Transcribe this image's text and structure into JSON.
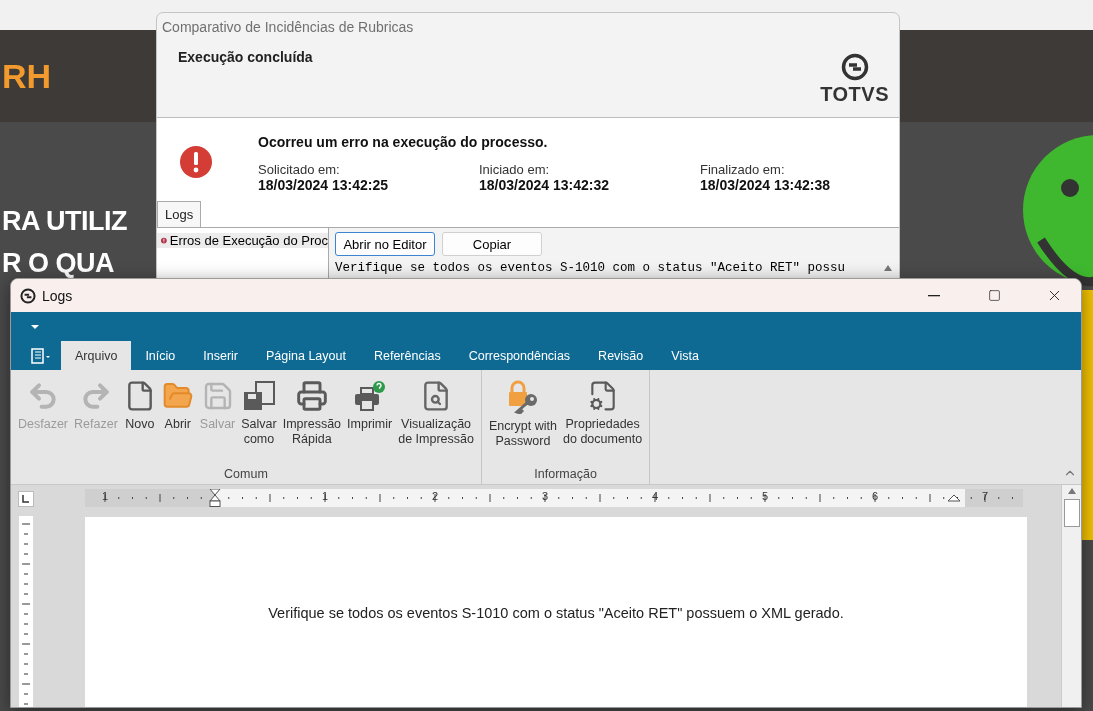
{
  "background_page": {
    "logo_text": "RH",
    "headline_lines": [
      "RA UTILIZ",
      "R O QUA"
    ]
  },
  "dialog": {
    "title": "Comparativo de Incidências de Rubricas",
    "heading": "Execução concluída",
    "brand": "TOTVS",
    "message": "Ocorreu um erro na execução do processo.",
    "times": [
      {
        "label": "Solicitado em:",
        "value": "18/03/2024 13:42:25"
      },
      {
        "label": "Iniciado em:",
        "value": "18/03/2024 13:42:32"
      },
      {
        "label": "Finalizado em:",
        "value": "18/03/2024 13:42:38"
      }
    ],
    "tabs": [
      {
        "label": "Logs",
        "selected": true
      }
    ],
    "log_items": [
      {
        "label": "Erros de Execução do Proc",
        "selected": true
      }
    ],
    "buttons": [
      {
        "label": "Abrir no Editor",
        "focused": true
      },
      {
        "label": "Copiar",
        "focused": false
      }
    ],
    "log_text": "Verifique se todos os eventos S-1010 com o status \"Aceito RET\" possu"
  },
  "logs_window": {
    "title": "Logs",
    "ribbon_tabs": [
      {
        "label": "Arquivo",
        "selected": true
      },
      {
        "label": "Início",
        "selected": false
      },
      {
        "label": "Inserir",
        "selected": false
      },
      {
        "label": "Página Layout",
        "selected": false
      },
      {
        "label": "Referências",
        "selected": false
      },
      {
        "label": "Correspondências",
        "selected": false
      },
      {
        "label": "Revisão",
        "selected": false
      },
      {
        "label": "Vista",
        "selected": false
      }
    ],
    "groups": [
      {
        "label": "Comum",
        "items": [
          {
            "label": "Desfazer",
            "kind": "undo",
            "disabled": true
          },
          {
            "label": "Refazer",
            "kind": "redo",
            "disabled": true
          },
          {
            "label": "Novo",
            "kind": "new",
            "disabled": false
          },
          {
            "label": "Abrir",
            "kind": "open",
            "disabled": false
          },
          {
            "label": "Salvar",
            "kind": "save",
            "disabled": true
          },
          {
            "label": "Salvar\ncomo",
            "kind": "save_as",
            "disabled": false
          },
          {
            "label": "Impressão\nRápida",
            "kind": "quick_print",
            "disabled": false
          },
          {
            "label": "Imprimir",
            "kind": "print",
            "disabled": false
          },
          {
            "label": "Visualização\nde Impressão",
            "kind": "print_preview",
            "disabled": false
          }
        ]
      },
      {
        "label": "Informação",
        "items": [
          {
            "label": "Encrypt with\nPassword",
            "kind": "encrypt",
            "disabled": false
          },
          {
            "label": "Propriedades\ndo documento",
            "kind": "properties",
            "disabled": false
          }
        ]
      }
    ],
    "ruler_labels": [
      "1",
      "1",
      "2",
      "3",
      "4",
      "5",
      "6",
      "7"
    ],
    "document_text": "Verifique se todos os eventos S-1010 com o status \"Aceito RET\" possuem o XML gerado."
  }
}
